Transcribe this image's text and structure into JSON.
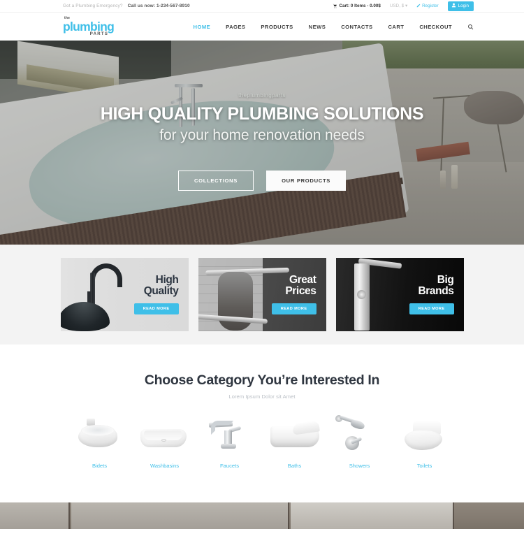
{
  "topbar": {
    "emergency_text": "Got a Plumbing Emergency?",
    "call_text": "Call us now: 1-234-567-8910",
    "cart_text": "Cart: 0 Items - 0.00$",
    "currency_text": "USD, $",
    "register_label": "Register",
    "login_label": "Login",
    "cart_icon": "cart-icon",
    "register_icon": "pencil-icon",
    "login_icon": "user-icon",
    "chevron_icon": "chevron-down-icon"
  },
  "header": {
    "logo": {
      "the": "the",
      "main": "plumbing",
      "parts": "PARTS"
    },
    "nav": [
      {
        "label": "HOME",
        "active": true
      },
      {
        "label": "PAGES",
        "active": false
      },
      {
        "label": "PRODUCTS",
        "active": false
      },
      {
        "label": "NEWS",
        "active": false
      },
      {
        "label": "CONTACTS",
        "active": false
      },
      {
        "label": "CART",
        "active": false
      },
      {
        "label": "CHECKOUT",
        "active": false
      }
    ],
    "search_icon": "search-icon"
  },
  "hero": {
    "kicker": "theplumbingparts",
    "heading": "HIGH QUALITY PLUMBING SOLUTIONS",
    "subheading": "for your home renovation needs",
    "btn_primary": "COLLECTIONS",
    "btn_secondary": "OUR PRODUCTS"
  },
  "promos": [
    {
      "title": "High\nQuality",
      "button": "READ MORE",
      "theme": "light"
    },
    {
      "title": "Great\nPrices",
      "button": "READ MORE",
      "theme": "dark"
    },
    {
      "title": "Big\nBrands",
      "button": "READ MORE",
      "theme": "black"
    }
  ],
  "categories_section": {
    "title": "Choose Category You’re Interested In",
    "subtitle": "Lorem Ipsum Dolor sit Amet",
    "items": [
      {
        "label": "Bidets",
        "icon": "bidet-icon"
      },
      {
        "label": "Washbasins",
        "icon": "washbasin-icon"
      },
      {
        "label": "Faucets",
        "icon": "faucet-icon"
      },
      {
        "label": "Baths",
        "icon": "bath-icon"
      },
      {
        "label": "Showers",
        "icon": "shower-icon"
      },
      {
        "label": "Toilets",
        "icon": "toilet-icon"
      }
    ]
  },
  "colors": {
    "accent": "#3fbfe8",
    "dark_text": "#2f3640",
    "muted": "#b9bec4",
    "promo_light_bg": "#e0e0e0",
    "promo_dark_bg": "#4b4b4b",
    "promo_black_bg": "#111111"
  }
}
